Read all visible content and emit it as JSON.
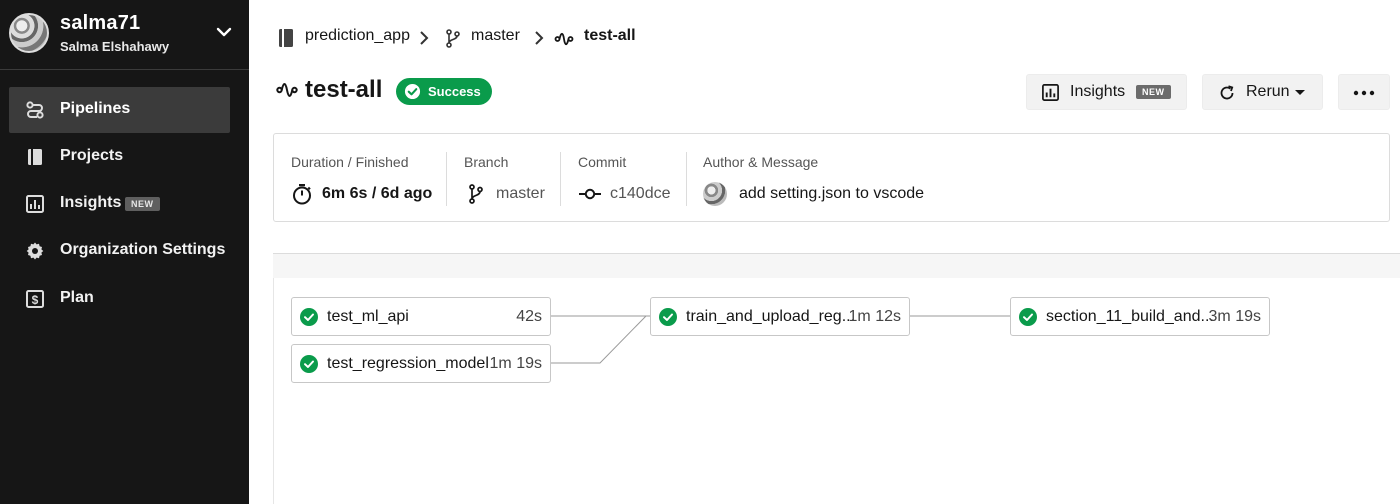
{
  "sidebar": {
    "org_name": "salma71",
    "user_name": "Salma Elshahawy",
    "items": [
      {
        "label": "Pipelines",
        "icon": "pipelines-icon",
        "active": true
      },
      {
        "label": "Projects",
        "icon": "projects-icon"
      },
      {
        "label": "Insights",
        "icon": "insights-icon",
        "badge": "NEW"
      },
      {
        "label": "Organization Settings",
        "icon": "gear-icon"
      },
      {
        "label": "Plan",
        "icon": "dollar-icon"
      }
    ]
  },
  "breadcrumb": {
    "project": "prediction_app",
    "branch": "master",
    "workflow": "test-all"
  },
  "header": {
    "title": "test-all",
    "status": "Success",
    "insights_label": "Insights",
    "insights_badge": "NEW",
    "rerun_label": "Rerun"
  },
  "summary": {
    "duration_header": "Duration / Finished",
    "duration_value": "6m 6s / 6d ago",
    "branch_header": "Branch",
    "branch_value": "master",
    "commit_header": "Commit",
    "commit_value": "c140dce",
    "author_header": "Author & Message",
    "message_value": "add setting.json to vscode"
  },
  "jobs": [
    {
      "name": "test_ml_api",
      "duration": "42s",
      "status": "success"
    },
    {
      "name": "test_regression_model",
      "duration": "1m 19s",
      "status": "success"
    },
    {
      "name": "train_and_upload_reg...",
      "duration": "1m 12s",
      "status": "success"
    },
    {
      "name": "section_11_build_and...",
      "duration": "3m 19s",
      "status": "success"
    }
  ],
  "colors": {
    "sidebar_bg": "#161616",
    "success_green": "#0a9b4b",
    "active_nav": "#3b3b3b"
  }
}
